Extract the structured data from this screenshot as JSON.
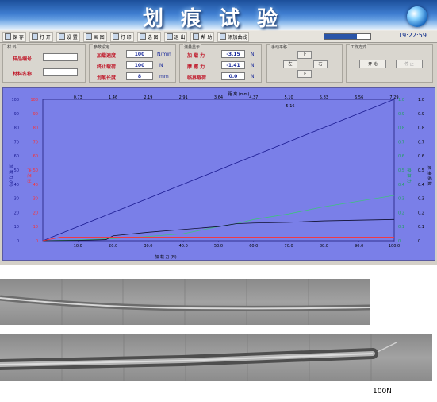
{
  "app": {
    "title": "划痕试验",
    "clock": "19:22:59",
    "progress": 0.7
  },
  "toolbar": {
    "items": [
      {
        "label": "保 存",
        "icon": "save-icon"
      },
      {
        "label": "打 开",
        "icon": "open-icon"
      },
      {
        "label": "设 置",
        "icon": "settings-icon"
      },
      {
        "label": "画 图",
        "icon": "plot-icon"
      },
      {
        "label": "打 印",
        "icon": "print-icon"
      },
      {
        "label": "选 图",
        "icon": "select-chart-icon"
      },
      {
        "label": "退 出",
        "icon": "exit-icon"
      },
      {
        "label": "帮 助",
        "icon": "help-icon"
      },
      {
        "label": "添加曲线",
        "icon": "add-curve-icon"
      }
    ]
  },
  "material": {
    "legend": "材 料",
    "sample_label": "样品编号",
    "sample_value": "",
    "name_label": "材料名称",
    "name_value": ""
  },
  "params": {
    "legend": "参数设定",
    "rate_label": "加载速度",
    "rate_value": "100",
    "rate_unit": "N/min",
    "stop_label": "终止载荷",
    "stop_value": "100",
    "stop_unit": "N",
    "length_label": "划痕长度",
    "length_value": "8",
    "length_unit": "mm"
  },
  "measure": {
    "legend": "测量显示",
    "load_label": "加 载 力",
    "load_value": "-3.15",
    "load_unit": "N",
    "friction_label": "摩 擦 力",
    "friction_value": "-1.41",
    "friction_unit": "N",
    "critical_label": "临界载荷",
    "critical_value": "0.0",
    "critical_unit": "N"
  },
  "direction": {
    "legend": "手动平移",
    "up": "上",
    "left": "左",
    "right": "右",
    "down": "下"
  },
  "control": {
    "legend": "工作方式",
    "start": "开 始",
    "stop": "停 止"
  },
  "chart_data": {
    "type": "line",
    "xlabel": "加 载 力 (N)",
    "top_xlabel": "距 离 (mm)",
    "xlim": [
      0,
      100
    ],
    "x_ticks": [
      "10.0",
      "20.0",
      "30.0",
      "40.0",
      "50.0",
      "60.0",
      "70.0",
      "80.0",
      "90.0",
      "100.0"
    ],
    "top_ticks": [
      "0.73",
      "1.46",
      "2.19",
      "2.91",
      "3.64",
      "4.37",
      "5.10",
      "5.83",
      "6.56",
      "7.29"
    ],
    "top_sub": "5.16",
    "left_ticks": [
      "0",
      "10",
      "20",
      "30",
      "40",
      "50",
      "60",
      "70",
      "80",
      "90",
      "100"
    ],
    "right_ticks": [
      "0",
      "0.1",
      "0.2",
      "0.3",
      "0.4",
      "0.5",
      "0.6",
      "0.7",
      "0.8",
      "0.9",
      "1.0"
    ],
    "left_label_blue": "加 载 力 (N)",
    "left_label_red": "声 发 射",
    "right_label_green": "摩 擦 力",
    "right_label_black": "摩 擦 系 数",
    "series": [
      {
        "color": "#1a1a90",
        "x": [
          0,
          100
        ],
        "y": [
          0,
          100
        ]
      },
      {
        "color": "#40c080",
        "x": [
          0,
          10,
          20,
          30,
          40,
          50,
          55,
          60,
          70,
          80,
          90,
          100
        ],
        "y": [
          0,
          0.6,
          1.5,
          3,
          5,
          10,
          12,
          15,
          19,
          24,
          28,
          32
        ]
      },
      {
        "color": "#101030",
        "x": [
          0,
          10,
          18,
          20,
          30,
          40,
          50,
          55,
          60,
          70,
          80,
          90,
          100
        ],
        "y": [
          0,
          0.3,
          0.8,
          3.5,
          6,
          8,
          10,
          12,
          12.5,
          13,
          14,
          14.5,
          15
        ]
      },
      {
        "color": "#ff3030",
        "x": [
          0,
          5,
          10,
          20,
          30,
          40,
          50,
          60,
          70,
          80,
          90,
          100
        ],
        "y": [
          0,
          2.5,
          2.5,
          2.5,
          2.5,
          2.5,
          2.5,
          2.5,
          2.5,
          2.5,
          2.5,
          2.5
        ]
      }
    ]
  },
  "caption": "100N"
}
